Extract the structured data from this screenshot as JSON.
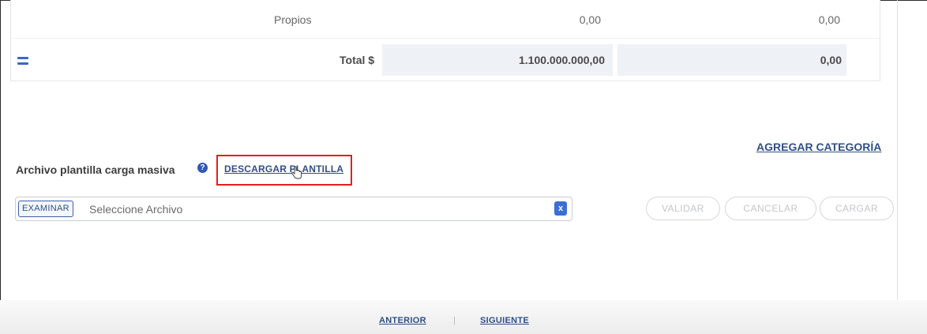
{
  "table": {
    "propios": {
      "label": "Propios",
      "value1": "0,00",
      "value2": "0,00"
    },
    "total": {
      "label": "Total $",
      "value1": "1.100.000.000,00",
      "value2": "0,00"
    }
  },
  "actions": {
    "agregar_categoria": "AGREGAR CATEGORÍA",
    "descargar_plantilla": "DESCARGAR PLANTILLA"
  },
  "upload": {
    "label": "Archivo plantilla carga masiva",
    "help_icon": "question-circle-icon",
    "examinar": "EXAMINAR",
    "placeholder": "Seleccione Archivo",
    "clear": "x",
    "validar": "VALIDAR",
    "cancelar": "CANCELAR",
    "cargar": "CARGAR"
  },
  "pager": {
    "anterior": "ANTERIOR",
    "separator": "|",
    "siguiente": "SIGUIENTE"
  },
  "colors": {
    "link": "#2f4f86",
    "accent": "#3b6fd8",
    "highlight_box": "#e0201b",
    "total_bg": "#eef2f6"
  }
}
